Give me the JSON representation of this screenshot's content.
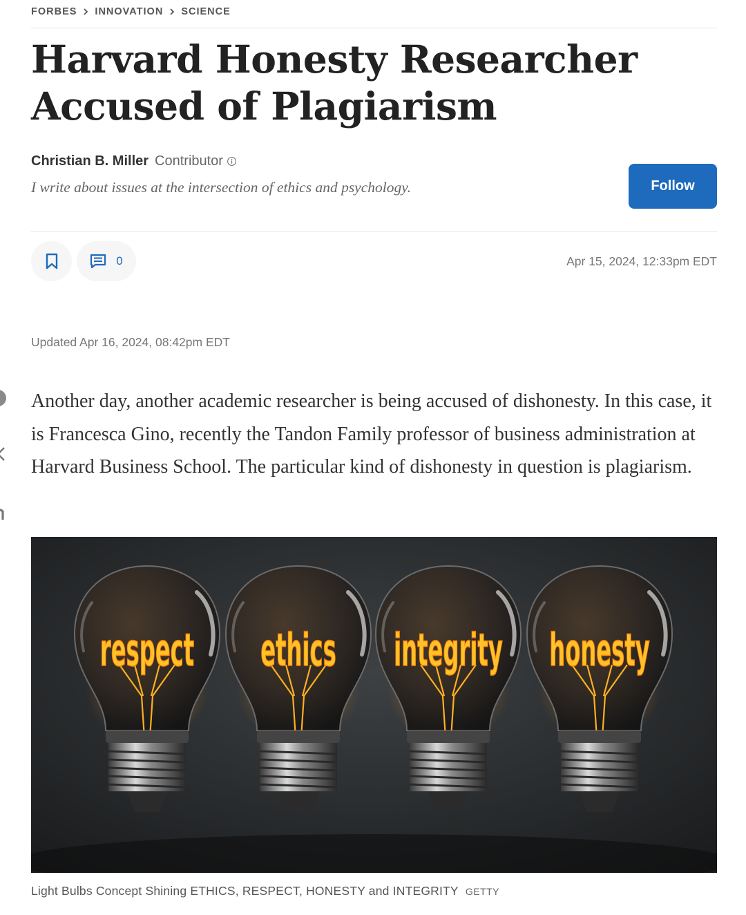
{
  "breadcrumb": {
    "items": [
      "FORBES",
      "INNOVATION",
      "SCIENCE"
    ]
  },
  "article": {
    "title_lines": [
      "Harvard Honesty Researcher",
      "Accused of Plagiarism"
    ],
    "published": "Apr 15, 2024, 12:33pm EDT",
    "updated": "Updated Apr 16, 2024, 08:42pm EDT",
    "lead": "Another day, another academic researcher is being accused of dishonesty. In this case, it is Francesca Gino, recently the Tandon Family professor of business administration at Harvard Business School. The particular kind of dishonesty in question is plagiarism."
  },
  "author": {
    "name": "Christian B. Miller",
    "role": "Contributor",
    "bio": "I write about issues at the intersection of ethics and psychology."
  },
  "follow_button": {
    "label": "Follow"
  },
  "actions": {
    "comment_count": "0",
    "save_icon": "bookmark-icon",
    "comment_icon": "comment-icon"
  },
  "image": {
    "bulb_words": [
      "respect",
      "ethics",
      "integrity",
      "honesty"
    ],
    "caption": "Light Bulbs Concept Shining ETHICS, RESPECT, HONESTY and INTEGRITY",
    "credit": "GETTY"
  },
  "colors": {
    "accent": "#1e6bbd",
    "title": "#222222",
    "filament_glow": "#ffb020"
  }
}
